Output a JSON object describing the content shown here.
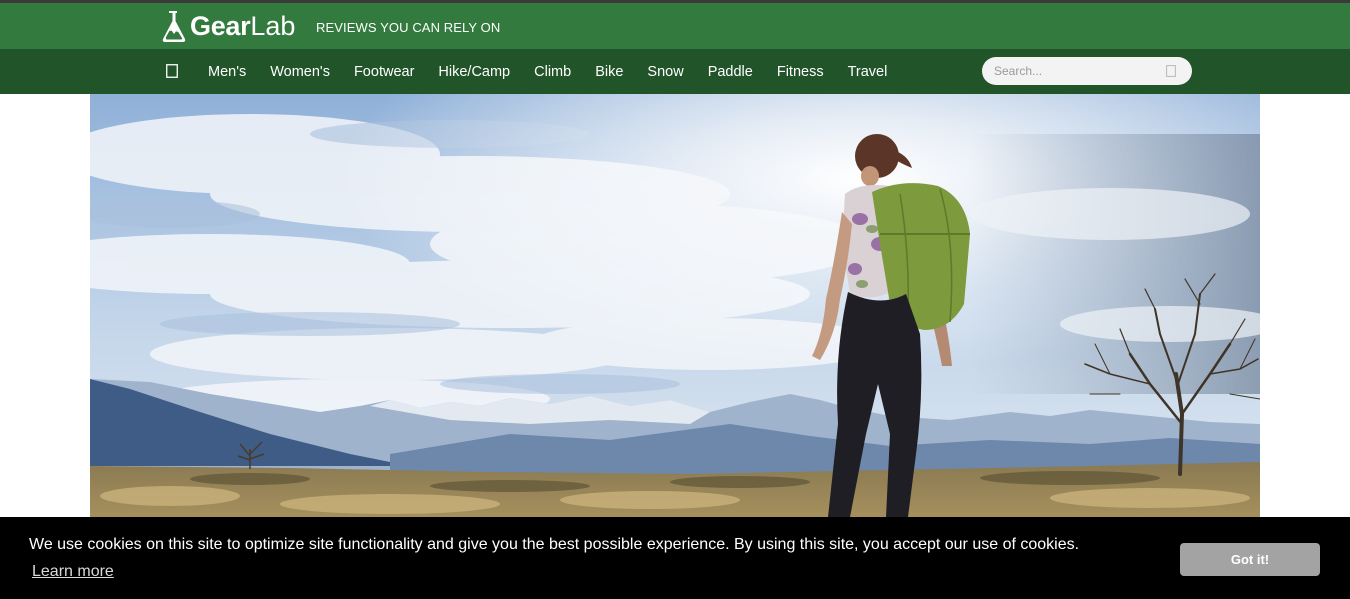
{
  "header": {
    "logo_gear": "Gear",
    "logo_lab": "Lab",
    "tagline": "REVIEWS YOU CAN RELY ON"
  },
  "nav": {
    "home_icon": "home-icon",
    "items": [
      {
        "label": "Men's"
      },
      {
        "label": "Women's"
      },
      {
        "label": "Footwear"
      },
      {
        "label": "Hike/Camp"
      },
      {
        "label": "Climb"
      },
      {
        "label": "Bike"
      },
      {
        "label": "Snow"
      },
      {
        "label": "Paddle"
      },
      {
        "label": "Fitness"
      },
      {
        "label": "Travel"
      }
    ],
    "search_placeholder": "Search...",
    "search_icon": "search-icon"
  },
  "hero": {
    "image": "hiker-with-green-backpack-facing-mountains"
  },
  "cookie_banner": {
    "message": "We use cookies on this site to optimize site functionality and give you the best possible experience. By using this site, you accept our use of cookies.",
    "learn_more": "Learn more",
    "accept_label": "Got it!"
  },
  "colors": {
    "brand_bar": "#327a3e",
    "nav_bar": "#215428",
    "cookie_bg": "#000000",
    "cookie_button": "#a3a3a3"
  }
}
